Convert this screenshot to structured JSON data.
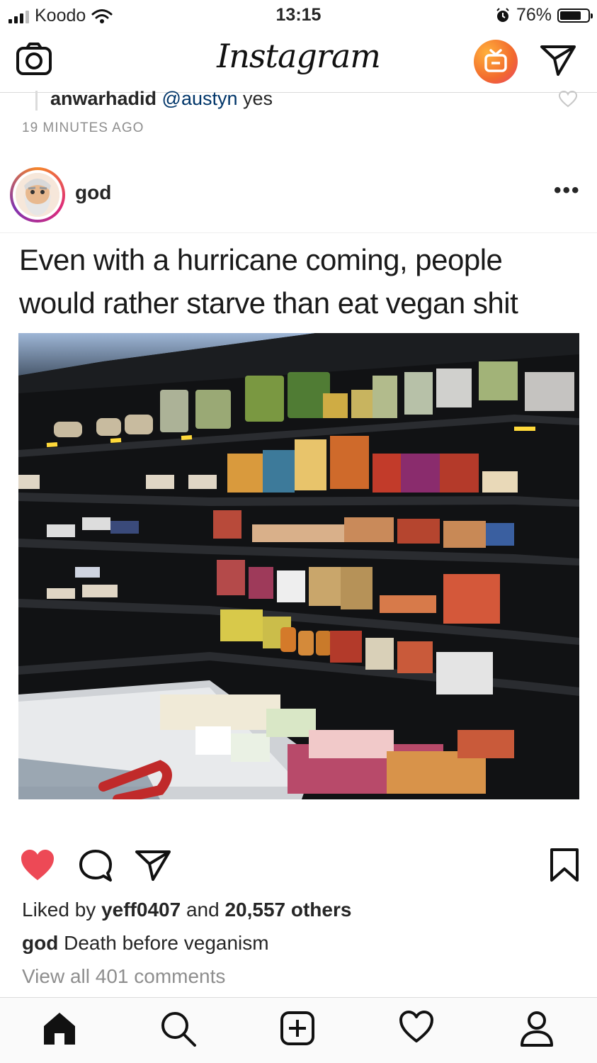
{
  "status_bar": {
    "carrier": "Koodo",
    "time": "13:15",
    "battery_percent": "76%",
    "battery_level": 0.76
  },
  "app": {
    "logo": "Instagram"
  },
  "previous_comment": {
    "username": "anwarhadid",
    "mention": "@austyn",
    "text": "yes",
    "timestamp": "19 MINUTES AGO"
  },
  "post": {
    "username": "god",
    "more_label": "•••",
    "caption_image_text": "Even with a hurricane coming, people would rather starve than eat vegan shit",
    "liked_by_prefix": "Liked by",
    "liked_by_user": "yeff0407",
    "liked_by_and": "and",
    "likes_others": "20,557 others",
    "caption_username": "god",
    "caption": "Death before veganism",
    "view_comments": "View all 401 comments"
  },
  "colors": {
    "like_red": "#ed4956",
    "link_blue": "#003569",
    "muted_gray": "#8e8e8e"
  },
  "icons": [
    "camera-icon",
    "igtv-icon",
    "direct-send-icon",
    "heart-outline-icon",
    "avatar-icon",
    "photo-shelf",
    "heart-filled-icon",
    "comment-icon",
    "share-icon",
    "bookmark-icon",
    "home-icon",
    "search-icon",
    "add-post-icon",
    "activity-heart-icon",
    "profile-icon"
  ]
}
